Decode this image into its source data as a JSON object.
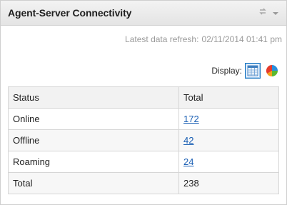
{
  "widget": {
    "title": "Agent-Server Connectivity",
    "refresh_label": "Latest data refresh:",
    "refresh_time": "02/11/2014 01:41 pm",
    "display_label": "Display:",
    "icons": [
      "refresh-icon",
      "dropdown-arrow-icon",
      "table-view-icon",
      "pie-chart-icon"
    ]
  },
  "table": {
    "headers": [
      "Status",
      "Total"
    ],
    "rows": [
      {
        "status": "Online",
        "total": "172"
      },
      {
        "status": "Offline",
        "total": "42"
      },
      {
        "status": "Roaming",
        "total": "24"
      },
      {
        "status": "Total",
        "total": "238"
      }
    ]
  },
  "colors": {
    "link": "#1a5fb4",
    "title_bar": "#e9e9e9",
    "pie": [
      "#e53b2c",
      "#2a8fdc",
      "#f3a21a",
      "#5cb82f"
    ]
  }
}
